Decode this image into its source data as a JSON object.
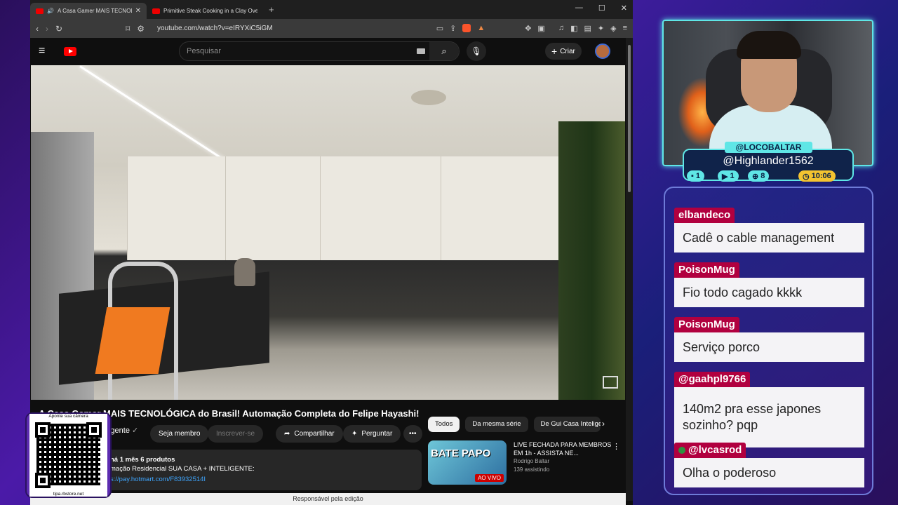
{
  "browser": {
    "tabs": [
      {
        "title": "A Casa Gamer MAIS TECNOLÓGICA do Brasil! Automação Completa do Felipe Hayashi!"
      },
      {
        "title": "Primitive Steak Cooking in a Clay Oven Built"
      }
    ],
    "url": "youtube.com/watch?v=eIRYXiC5iGM"
  },
  "youtube": {
    "search_placeholder": "Pesquisar",
    "create_label": "Criar",
    "video_title": "A Casa Gamer MAIS TECNOLÓGICA do Brasil! Automação Completa do Felipe Hayashi!",
    "channel_name": "igente",
    "buttons": {
      "member": "Seja membro",
      "subscribe": "Inscrever-se",
      "share": "Compartilhar",
      "ask": "Perguntar"
    },
    "description": {
      "meta": "há 1 mês  6 produtos",
      "line1": "mação Residencial SUA CASA + INTELIGENTE:",
      "link": "s://pay.hotmart.com/F83932514I"
    },
    "chips": [
      "Todos",
      "Da mesma série",
      "De Gui Casa Inteligente"
    ],
    "recommendation": {
      "thumb_text": "BATE PAPO",
      "live_badge": "AO VIVO",
      "title": "LIVE FECHADA PARA MEMBROS EM 1h - ASSISTA NE...",
      "channel": "Rodrigo Baltar",
      "viewers": "139 assistindo"
    },
    "footer": "Responsável pela edição"
  },
  "overlay": {
    "qr_top": "Aponte sua câmera",
    "qr_bottom": "tipa.rbstore.net",
    "streamer_handle": "@LOCOBALTAR",
    "viewer_handle": "@Highlander1562",
    "stats": {
      "chat": "1",
      "yt": "1",
      "sub": "8",
      "time": "10:06"
    }
  },
  "chat": [
    {
      "user": "elbandeco",
      "text": "Cadê o cable management"
    },
    {
      "user": "PoisonMug",
      "text": "Fio todo cagado kkkk"
    },
    {
      "user": "PoisonMug",
      "text": "Serviço porco"
    },
    {
      "user": "@gaahpl9766",
      "text": "140m2 pra esse japones sozinho? pqp"
    },
    {
      "user": "@lvcasrod",
      "text": "Olha o poderoso"
    }
  ]
}
